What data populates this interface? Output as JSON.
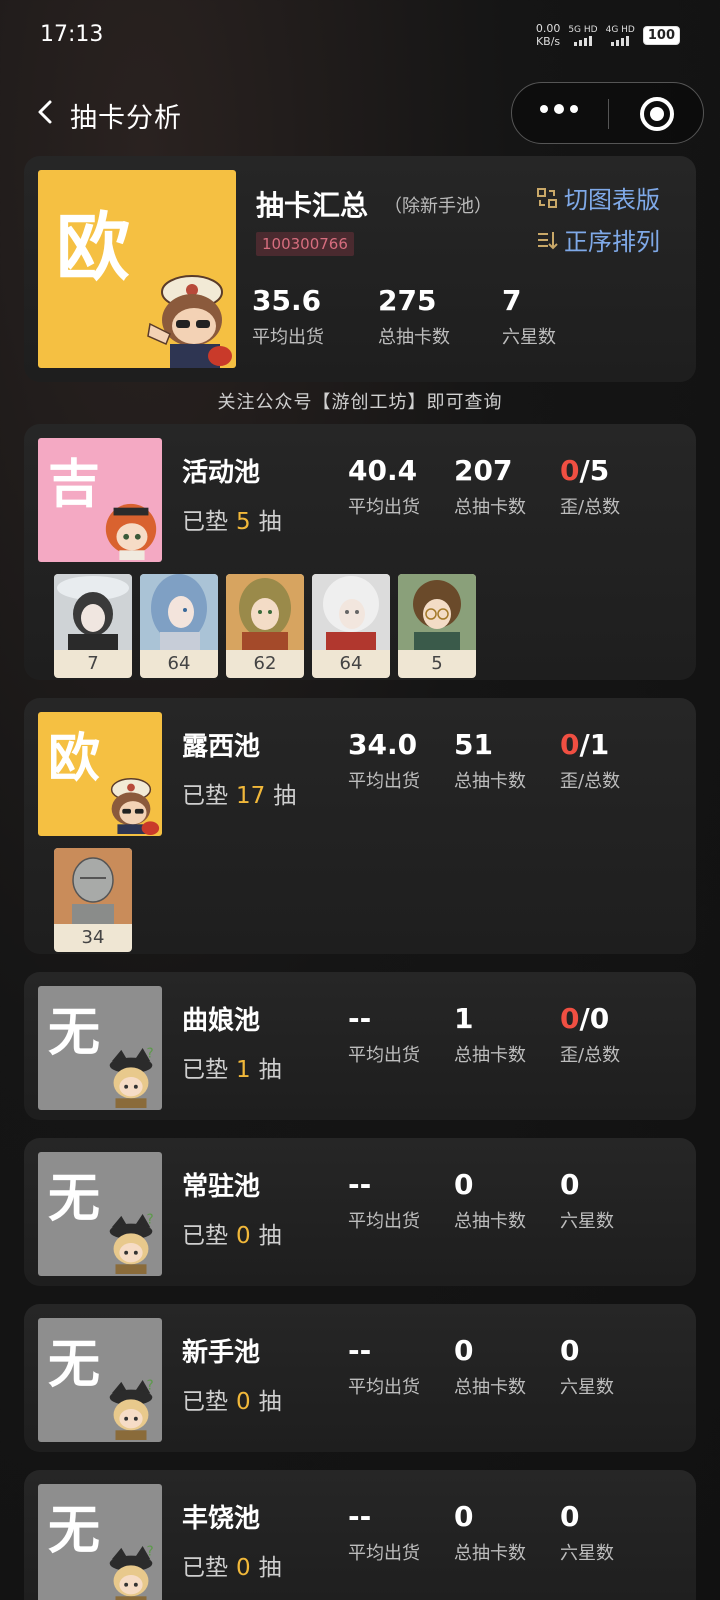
{
  "status_bar": {
    "time": "17:13",
    "net_speed": "0.00",
    "net_unit": "KB/s",
    "sim1": "5G HD",
    "sim2": "4G HD",
    "battery": "100"
  },
  "nav": {
    "title": "抽卡分析"
  },
  "summary": {
    "badge": "欧",
    "title": "抽卡汇总",
    "subtitle": "（除新手池）",
    "uid": "100300766",
    "actions": {
      "switch_view": "切图表版",
      "sort": "正序排列"
    },
    "stats": [
      {
        "value": "35.6",
        "label": "平均出货"
      },
      {
        "value": "275",
        "label": "总抽卡数"
      },
      {
        "value": "7",
        "label": "六星数"
      }
    ]
  },
  "notice": "关注公众号【游创工坊】即可查询",
  "pools": [
    {
      "badge": "吉",
      "badge_color": "#f4a9c3",
      "name": "活动池",
      "pity_prefix": "已垫",
      "pity": "5",
      "pity_suffix": "抽",
      "avg": "40.4",
      "avg_label": "平均出货",
      "total": "207",
      "total_label": "总抽卡数",
      "third_red": "0",
      "third_rest": "/5",
      "third_label": "歪/总数",
      "chars": [
        {
          "count": "7",
          "icon": "character-portrait-white-hat"
        },
        {
          "count": "64",
          "icon": "character-portrait-blue-hair"
        },
        {
          "count": "62",
          "icon": "character-portrait-blonde"
        },
        {
          "count": "64",
          "icon": "character-portrait-silver-hair"
        },
        {
          "count": "5",
          "icon": "character-portrait-glasses"
        }
      ]
    },
    {
      "badge": "欧",
      "badge_color": "#f5c042",
      "name": "露西池",
      "pity_prefix": "已垫",
      "pity": "17",
      "pity_suffix": "抽",
      "avg": "34.0",
      "avg_label": "平均出货",
      "total": "51",
      "total_label": "总抽卡数",
      "third_red": "0",
      "third_rest": "/1",
      "third_label": "歪/总数",
      "chars": [
        {
          "count": "34",
          "icon": "character-portrait-statue"
        }
      ]
    },
    {
      "badge": "无",
      "badge_color": "#8e8e8e",
      "name": "曲娘池",
      "pity_prefix": "已垫",
      "pity": "1",
      "pity_suffix": "抽",
      "avg": "--",
      "avg_label": "平均出货",
      "total": "1",
      "total_label": "总抽卡数",
      "third_red": "0",
      "third_rest": "/0",
      "third_label": "歪/总数",
      "chars": []
    },
    {
      "badge": "无",
      "badge_color": "#8e8e8e",
      "name": "常驻池",
      "pity_prefix": "已垫",
      "pity": "0",
      "pity_suffix": "抽",
      "avg": "--",
      "avg_label": "平均出货",
      "total": "0",
      "total_label": "总抽卡数",
      "third_red": "",
      "third_rest": "0",
      "third_label": "六星数",
      "chars": []
    },
    {
      "badge": "无",
      "badge_color": "#8e8e8e",
      "name": "新手池",
      "pity_prefix": "已垫",
      "pity": "0",
      "pity_suffix": "抽",
      "avg": "--",
      "avg_label": "平均出货",
      "total": "0",
      "total_label": "总抽卡数",
      "third_red": "",
      "third_rest": "0",
      "third_label": "六星数",
      "chars": []
    },
    {
      "badge": "无",
      "badge_color": "#8e8e8e",
      "name": "丰饶池",
      "pity_prefix": "已垫",
      "pity": "0",
      "pity_suffix": "抽",
      "avg": "--",
      "avg_label": "平均出货",
      "total": "0",
      "total_label": "总抽卡数",
      "third_red": "",
      "third_rest": "0",
      "third_label": "六星数",
      "chars": []
    }
  ]
}
